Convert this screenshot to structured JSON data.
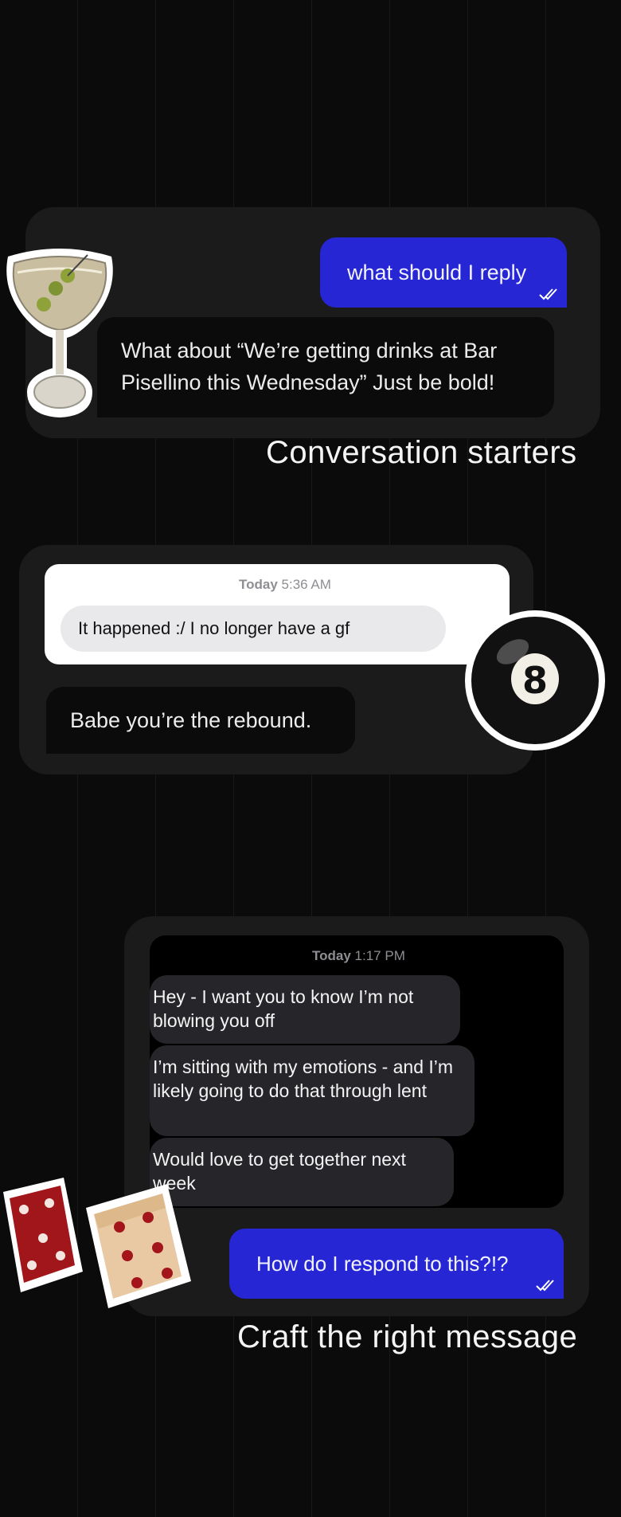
{
  "section1": {
    "user_message": "what should I reply",
    "ai_reply": "What about “We’re getting drinks at Bar Pisellino this Wednesday” Just be bold!",
    "heading": "Conversation starters",
    "sticker": "martini-glass-icon"
  },
  "section2": {
    "timestamp_day": "Today",
    "timestamp_time": "5:36 AM",
    "received_message": "It happened :/ I no longer have a gf",
    "ai_reply": "Babe you’re the rebound.",
    "sticker": "eight-ball-icon"
  },
  "section3": {
    "timestamp_day": "Today",
    "timestamp_time": "1:17 PM",
    "messages": [
      "Hey - I want you to know I’m not blowing you off",
      "I’m sitting with my emotions - and I’m likely going to do that through lent",
      "Would love to get together next week"
    ],
    "user_message": "How do I respond to this?!?",
    "heading": "Craft the right message",
    "sticker": "dice-icon"
  },
  "colors": {
    "background": "#0b0b0c",
    "card": "#1b1b1c",
    "accent_blue": "#2626d4"
  }
}
